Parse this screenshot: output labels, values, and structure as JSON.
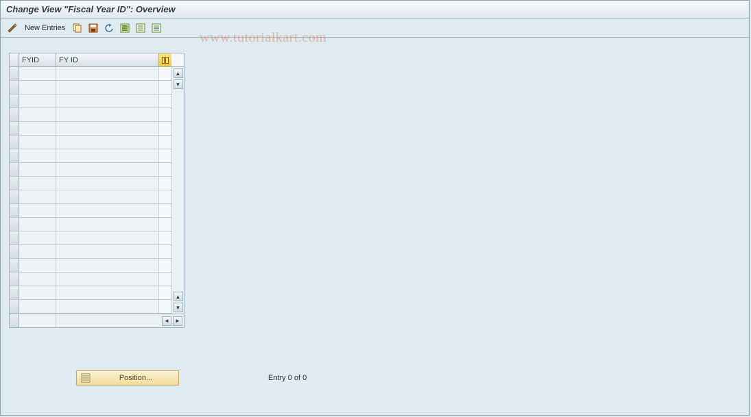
{
  "title": "Change View \"Fiscal Year ID\": Overview",
  "toolbar": {
    "new_entries_label": "New Entries"
  },
  "watermark": "www.tutorialkart.com",
  "table": {
    "columns": {
      "c1": "FYID",
      "c2": "FY ID"
    },
    "row_count": 18
  },
  "position_button": {
    "label": "Position..."
  },
  "entry_status": "Entry 0 of 0"
}
